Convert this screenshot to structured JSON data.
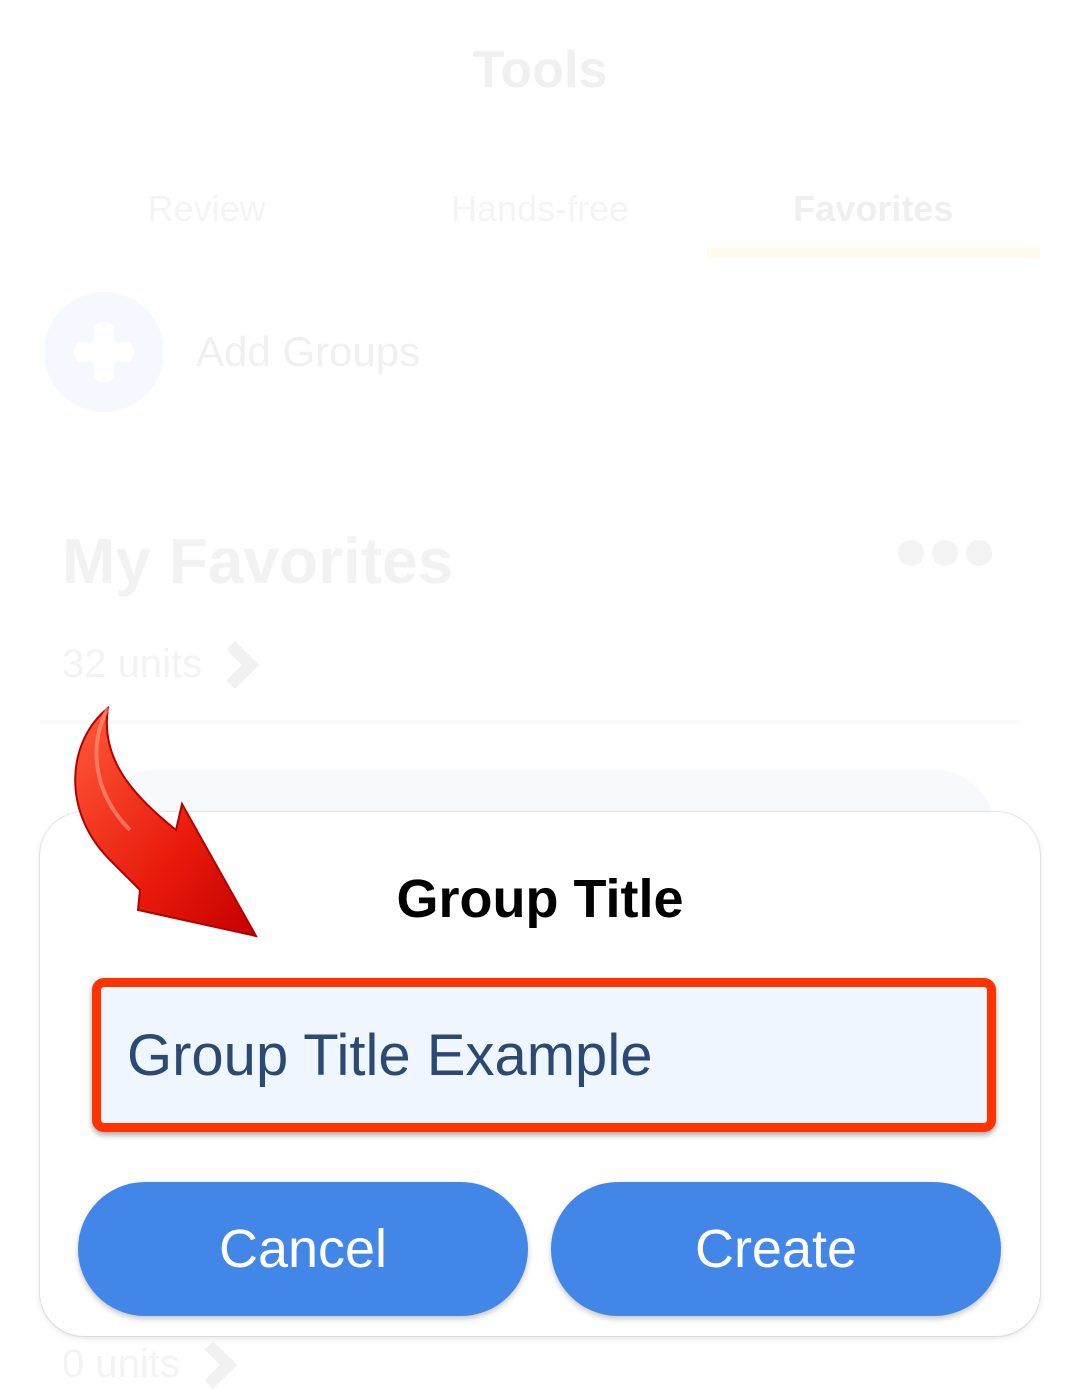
{
  "screen": {
    "title": "Tools",
    "tabs": [
      {
        "label": "Review",
        "active": false
      },
      {
        "label": "Hands-free",
        "active": false
      },
      {
        "label": "Favorites",
        "active": true
      }
    ],
    "add_groups_label": "Add Groups",
    "favorites_card": {
      "title": "My Favorites",
      "count": "32 units"
    },
    "second_card_count": "0 units"
  },
  "dialog": {
    "title": "Group Title",
    "input_value": "Group Title Example",
    "cancel_label": "Cancel",
    "create_label": "Create"
  },
  "colors": {
    "button": "#4287e8",
    "highlight": "#ff3300",
    "input_text": "#2a4a73"
  }
}
